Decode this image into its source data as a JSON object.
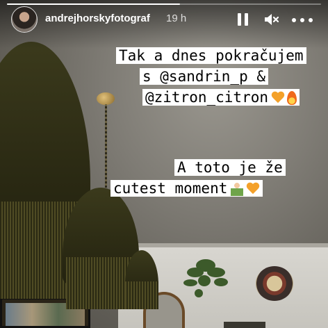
{
  "story": {
    "username": "andrejhorskyfotograf",
    "time_ago": "19 h",
    "progress": 0.55
  },
  "controls": {
    "pause_icon": "pause-icon",
    "mute_icon": "speaker-muted-icon",
    "more_icon": "more-dots-icon"
  },
  "captions": {
    "first": {
      "lines": [
        "Tak a dnes pokračujem",
        "s @sandrin_p &",
        "@zitron_citron"
      ],
      "emojis": [
        "orange-heart",
        "fire"
      ]
    },
    "second": {
      "lines": [
        "A toto je že",
        "cutest moment"
      ],
      "emojis": [
        "person-gesturing",
        "orange-heart"
      ]
    }
  },
  "colors": {
    "caption_bg": "#ffffff",
    "caption_text": "#000000",
    "heart": "#f4a12a"
  }
}
